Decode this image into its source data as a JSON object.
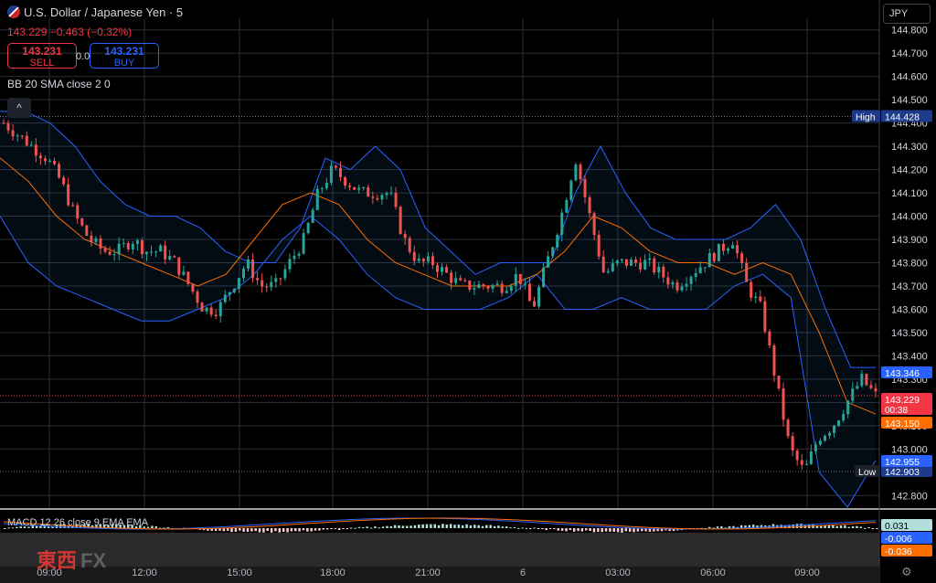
{
  "header": {
    "title": "U.S. Dollar / Japanese Yen · 5",
    "quote": "143.229  −0.463 (−0.32%)",
    "sell_price": "143.231",
    "sell_label": "SELL",
    "buy_price": "143.231",
    "buy_label": "BUY",
    "spread": "0.0",
    "indicator_bb": "BB 20 SMA close 2 0",
    "indicator_macd": "MACD 12 26 close 9 EMA EMA",
    "currency": "JPY",
    "collapse_glyph": "^"
  },
  "badges": {
    "high_label": "High",
    "high_value": "144.428",
    "low_label": "Low",
    "low_value": "142.903",
    "upper_band": "143.346",
    "last_price": "143.229",
    "countdown": "00:38",
    "basis": "143.150",
    "lower_band": "142.955",
    "macd_hist": "0.031",
    "macd_line": "-0.006",
    "signal_line": "-0.036"
  },
  "logo": {
    "cn": "東西",
    "fx": "FX"
  },
  "colors": {
    "up": "#26a69a",
    "down": "#ef5350",
    "band": "#2962ff",
    "basis": "#ff6d00",
    "last": "#f23645"
  },
  "icons": {
    "settings": "gear-icon",
    "collapse": "chevron-up-icon",
    "flag": "us-flag-icon"
  },
  "chart_data": {
    "type": "candlestick",
    "ylim": [
      142.75,
      144.85
    ],
    "y_ticks": [
      "144.800",
      "144.700",
      "144.600",
      "144.500",
      "144.400",
      "144.300",
      "144.200",
      "144.100",
      "144.000",
      "143.900",
      "143.800",
      "143.700",
      "143.600",
      "143.500",
      "143.400",
      "143.300",
      "143.200",
      "143.100",
      "143.000",
      "142.800"
    ],
    "x_ticks": [
      "09:00",
      "12:00",
      "15:00",
      "18:00",
      "21:00",
      "6",
      "03:00",
      "06:00",
      "09:00"
    ],
    "series": [
      {
        "name": "Price",
        "close_path": [
          144.4,
          144.35,
          144.3,
          144.25,
          144.15,
          144.0,
          143.9,
          143.85,
          143.85,
          143.9,
          143.85,
          143.85,
          143.8,
          143.7,
          143.6,
          143.6,
          143.7,
          143.8,
          143.7,
          143.7,
          143.8,
          143.9,
          144.1,
          144.2,
          144.15,
          144.1,
          144.1,
          144.1,
          143.9,
          143.8,
          143.8,
          143.75,
          143.7,
          143.7,
          143.7,
          143.7,
          143.75,
          143.6,
          143.8,
          144.0,
          144.25,
          144.0,
          143.75,
          143.8,
          143.8,
          143.8,
          143.75,
          143.7,
          143.75,
          143.8,
          143.85,
          143.9,
          143.7,
          143.6,
          143.3,
          143.0,
          142.9,
          143.05,
          143.1,
          143.2,
          143.3,
          143.23
        ]
      },
      {
        "name": "BB Upper",
        "path": [
          144.45,
          144.45,
          144.4,
          144.3,
          144.15,
          144.05,
          144.0,
          144.0,
          143.95,
          143.85,
          143.8,
          143.8,
          143.95,
          144.25,
          144.2,
          144.3,
          144.2,
          143.95,
          143.85,
          143.75,
          143.8,
          143.8,
          143.8,
          144.1,
          144.3,
          144.1,
          143.95,
          143.9,
          143.9,
          143.9,
          143.95,
          144.05,
          143.9,
          143.6,
          143.35,
          143.35
        ]
      },
      {
        "name": "BB Lower",
        "path": [
          144.0,
          143.8,
          143.7,
          143.65,
          143.6,
          143.55,
          143.55,
          143.6,
          143.65,
          143.75,
          143.9,
          144.0,
          143.9,
          143.75,
          143.65,
          143.6,
          143.6,
          143.6,
          143.65,
          143.75,
          143.6,
          143.6,
          143.65,
          143.6,
          143.6,
          143.6,
          143.7,
          143.75,
          143.65,
          142.9,
          142.75,
          142.95
        ]
      },
      {
        "name": "BB Basis",
        "path": [
          144.25,
          144.15,
          144.0,
          143.9,
          143.85,
          143.8,
          143.75,
          143.7,
          143.75,
          143.9,
          144.05,
          144.1,
          144.05,
          143.9,
          143.8,
          143.75,
          143.7,
          143.7,
          143.7,
          143.75,
          143.85,
          144.0,
          143.95,
          143.85,
          143.8,
          143.8,
          143.75,
          143.8,
          143.75,
          143.5,
          143.2,
          143.15
        ]
      }
    ],
    "high": 144.428,
    "low": 142.903,
    "last": 143.229
  }
}
